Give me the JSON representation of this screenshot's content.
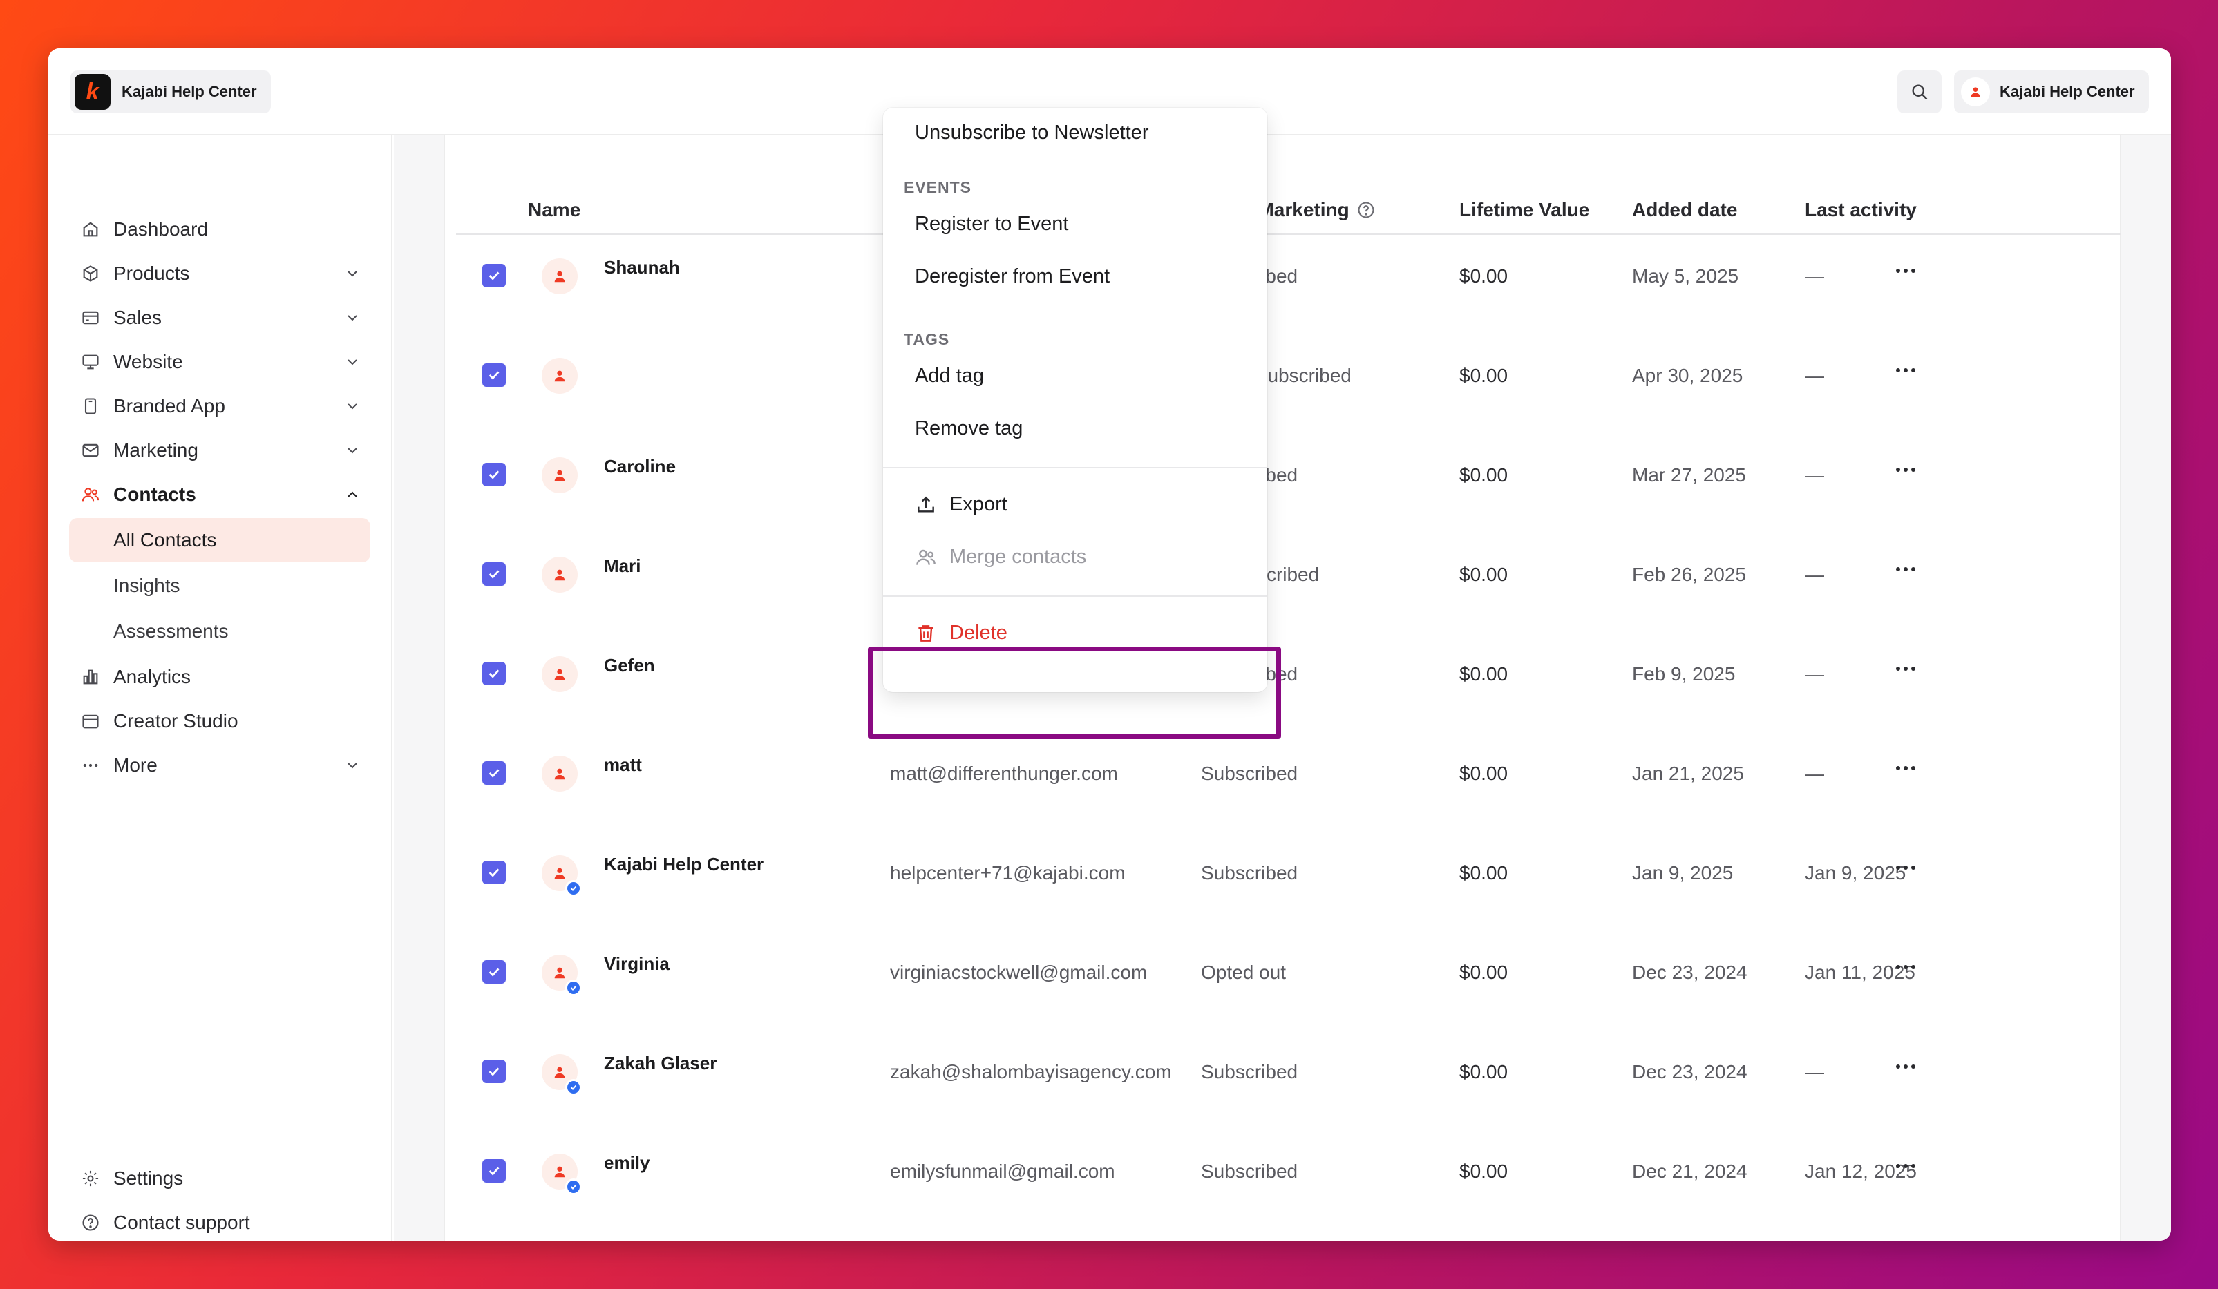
{
  "app": {
    "brand": "Kajabi Help Center",
    "account_name": "Kajabi Help Center"
  },
  "colors": {
    "accent": "#5b5fe8",
    "brand": "#ff4a14",
    "danger": "#e0322a",
    "highlight": "#8a0a82"
  },
  "sidebar": {
    "items": [
      {
        "label": "Dashboard",
        "icon": "home-icon"
      },
      {
        "label": "Products",
        "icon": "box-icon"
      },
      {
        "label": "Sales",
        "icon": "card-icon"
      },
      {
        "label": "Website",
        "icon": "monitor-icon"
      },
      {
        "label": "Branded App",
        "icon": "phone-icon"
      },
      {
        "label": "Marketing",
        "icon": "mail-icon"
      },
      {
        "label": "Contacts",
        "icon": "contacts-icon"
      },
      {
        "label": "Analytics",
        "icon": "bar-chart-icon"
      },
      {
        "label": "Creator Studio",
        "icon": "calendar-icon"
      },
      {
        "label": "More",
        "icon": "more-icon"
      }
    ],
    "contacts_sub": [
      {
        "label": "All Contacts"
      },
      {
        "label": "Insights"
      },
      {
        "label": "Assessments"
      }
    ],
    "footer": [
      {
        "label": "Settings",
        "icon": "gear-icon"
      },
      {
        "label": "Contact support",
        "icon": "help-icon"
      }
    ]
  },
  "table": {
    "headers": {
      "name": "Name",
      "email_marketing": "Email Marketing",
      "lifetime_value": "Lifetime Value",
      "added_date": "Added date",
      "last_activity": "Last activity"
    },
    "rows": [
      {
        "name": "Shaunah",
        "email": "",
        "marketing": "Subscribed",
        "value": "$0.00",
        "added": "May 5, 2025",
        "activity": "—",
        "verified": false
      },
      {
        "name": "",
        "email": "",
        "marketing": "Never subscribed",
        "value": "$0.00",
        "added": "Apr 30, 2025",
        "activity": "—",
        "verified": false
      },
      {
        "name": "Caroline",
        "email": "",
        "marketing": "Subscribed",
        "value": "$0.00",
        "added": "Mar 27, 2025",
        "activity": "—",
        "verified": false
      },
      {
        "name": "Mari",
        "email": "",
        "marketing": "Unsubscribed",
        "value": "$0.00",
        "added": "Feb 26, 2025",
        "activity": "—",
        "verified": false
      },
      {
        "name": "Gefen",
        "email": "",
        "marketing": "Subscribed",
        "value": "$0.00",
        "added": "Feb 9, 2025",
        "activity": "—",
        "verified": false
      },
      {
        "name": "matt",
        "email": "matt@differenthunger.com",
        "marketing": "Subscribed",
        "value": "$0.00",
        "added": "Jan 21, 2025",
        "activity": "—",
        "verified": false
      },
      {
        "name": "Kajabi Help Center",
        "email": "helpcenter+71@kajabi.com",
        "marketing": "Subscribed",
        "value": "$0.00",
        "added": "Jan 9, 2025",
        "activity": "Jan 9, 2025",
        "verified": true
      },
      {
        "name": "Virginia",
        "email": "virginiacstockwell@gmail.com",
        "marketing": "Opted out",
        "value": "$0.00",
        "added": "Dec 23, 2024",
        "activity": "Jan 11, 2025",
        "verified": true
      },
      {
        "name": "Zakah Glaser",
        "email": "zakah@shalombayisagency.com",
        "marketing": "Subscribed",
        "value": "$0.00",
        "added": "Dec 23, 2024",
        "activity": "—",
        "verified": true
      },
      {
        "name": "emily",
        "email": "emilysfunmail@gmail.com",
        "marketing": "Subscribed",
        "value": "$0.00",
        "added": "Dec 21, 2024",
        "activity": "Jan 12, 2025",
        "verified": true
      }
    ]
  },
  "menu": {
    "top_item": "Unsubscribe to Newsletter",
    "events_section": "EVENTS",
    "register": "Register to Event",
    "deregister": "Deregister from Event",
    "tags_section": "TAGS",
    "add_tag": "Add tag",
    "remove_tag": "Remove tag",
    "export": "Export",
    "merge": "Merge contacts",
    "delete": "Delete"
  }
}
